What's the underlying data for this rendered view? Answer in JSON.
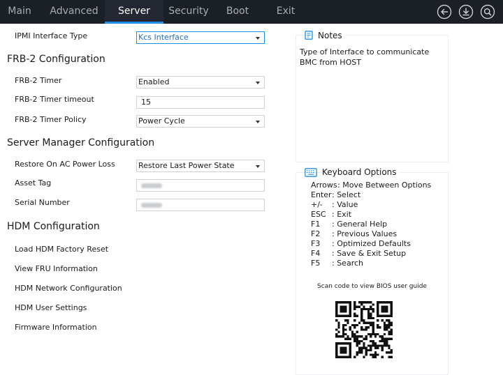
{
  "nav": {
    "tabs": [
      {
        "label": "Main"
      },
      {
        "label": "Advanced"
      },
      {
        "label": "Server"
      },
      {
        "label": "Security"
      },
      {
        "label": "Boot"
      },
      {
        "label": "Exit"
      }
    ],
    "active_tab": "Server",
    "icons": [
      "back-icon",
      "download-icon",
      "search-icon"
    ],
    "accent_color": "#1e8fe6"
  },
  "form": {
    "ipmi": {
      "label": "IPMI Interface Type",
      "value": "Kcs Interface"
    },
    "frb2": {
      "title": "FRB-2 Configuration",
      "timer": {
        "label": "FRB-2 Timer",
        "value": "Enabled"
      },
      "timeout": {
        "label": "FRB-2 Timer timeout",
        "value": "15"
      },
      "policy": {
        "label": "FRB-2 Timer Policy",
        "value": "Power Cycle"
      }
    },
    "server_manager": {
      "title": "Server Manager Configuration",
      "restore": {
        "label": "Restore On AC Power Loss",
        "value": "Restore Last Power State"
      },
      "asset_tag": {
        "label": "Asset Tag"
      },
      "serial": {
        "label": "Serial Number"
      }
    },
    "hdm": {
      "title": "HDM Configuration",
      "items": [
        "Load HDM Factory Reset",
        "View FRU Information",
        "HDM Network Configuration",
        "HDM User Settings",
        "Firmware Information"
      ]
    }
  },
  "notes": {
    "title": "Notes",
    "text": "Type of Interface to communicate BMC from HOST"
  },
  "keyboard": {
    "title": "Keyboard Options",
    "rows": [
      {
        "key": "Arrows",
        "desc": ": Move Between Options"
      },
      {
        "key": "Enter",
        "desc": ": Select"
      },
      {
        "key": "+/-",
        "desc": ": Value"
      },
      {
        "key": "ESC",
        "desc": ": Exit"
      },
      {
        "key": "F1",
        "desc": ": General Help"
      },
      {
        "key": "F2",
        "desc": ": Previous Values"
      },
      {
        "key": "F3",
        "desc": ": Optimized Defaults"
      },
      {
        "key": "F4",
        "desc": ": Save & Exit Setup"
      },
      {
        "key": "F5",
        "desc": ": Search"
      }
    ],
    "qr_caption": "Scan code to view BIOS user guide"
  }
}
